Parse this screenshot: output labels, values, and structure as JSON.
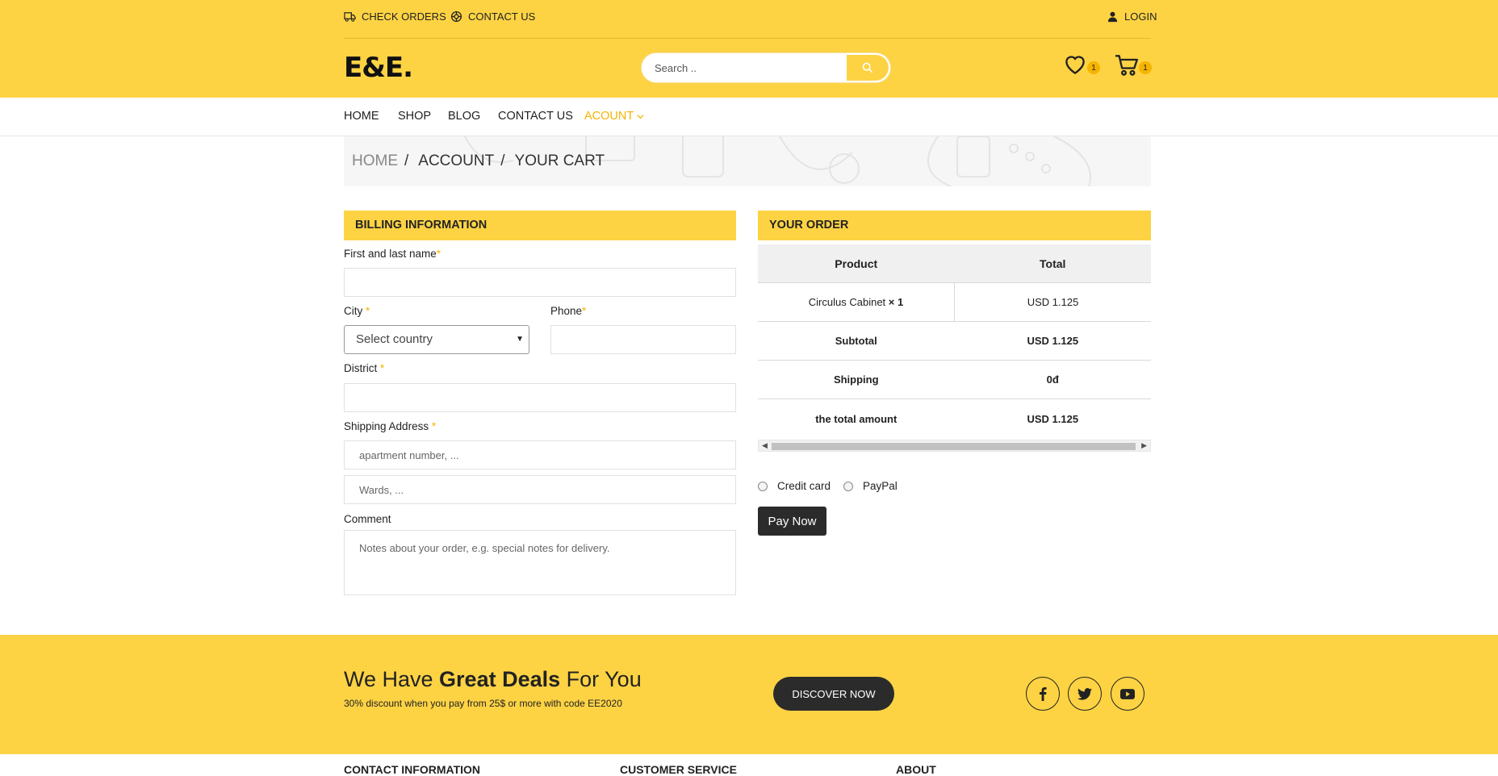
{
  "topbar": {
    "check_orders": "CHECK ORDERS",
    "contact_us": "CONTACT US",
    "login": "LOGIN",
    "logo": "E&E.",
    "search_placeholder": "Search ..",
    "wishlist_count": "1",
    "cart_count": "1"
  },
  "nav": {
    "items": [
      "HOME",
      "SHOP",
      "BLOG",
      "CONTACT US",
      "ACOUNT"
    ]
  },
  "breadcrumb": [
    "HOME",
    "ACCOUNT",
    "YOUR CART"
  ],
  "billing": {
    "title": "BILLING INFORMATION",
    "name_label": "First and last name",
    "city_label": "City ",
    "city_select": "Select country",
    "phone_label": "Phone",
    "district_label": "District ",
    "address_label": "Shipping Address ",
    "address_placeholder_1": "apartment number, ...",
    "address_placeholder_2": "Wards, ...",
    "comment_label": "Comment",
    "comment_placeholder": "Notes about your order, e.g. special notes for delivery.",
    "required_mark": "*"
  },
  "order": {
    "title": "YOUR ORDER",
    "headers": [
      "Product",
      "Total"
    ],
    "product_name": "Circulus Cabinet",
    "product_qty": "× 1",
    "product_total": "USD 1.125",
    "subtotal_label": "Subtotal",
    "subtotal_value": "USD 1.125",
    "shipping_label": "Shipping",
    "shipping_value": "0đ",
    "total_label": "the total amount",
    "total_value": "USD 1.125"
  },
  "payment": {
    "credit_card": "Credit card",
    "paypal": "PayPal",
    "pay_now": "Pay Now"
  },
  "banner": {
    "deal_prefix": "We Have ",
    "deal_bold": "Great Deals",
    "deal_suffix": " For You",
    "subtext": "30% discount when you pay from 25$ or more with code EE2020",
    "discover": "DISCOVER NOW"
  },
  "footer": {
    "headings": [
      "CONTACT INFORMATION",
      "CUSTOMER SERVICE",
      "ABOUT"
    ]
  },
  "colors": {
    "brand_yellow": "#fdd344",
    "accent": "#f5b400",
    "dark_button": "#2b2b2b"
  }
}
